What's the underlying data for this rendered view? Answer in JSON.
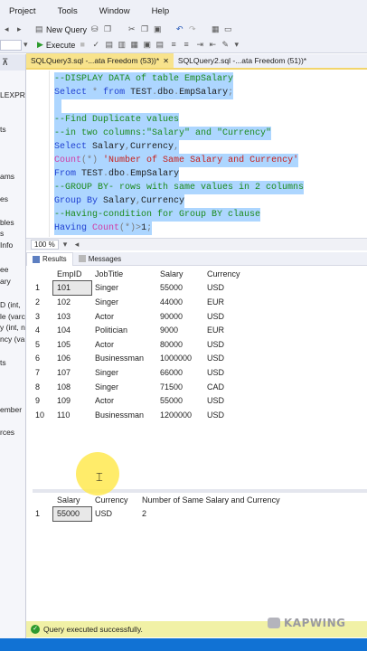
{
  "menu": [
    "Project",
    "Tools",
    "Window",
    "Help"
  ],
  "toolbar": {
    "new_query_label": "New Query",
    "execute_label": "Execute"
  },
  "left_panel": {
    "items": [
      "LEXPR",
      "ts",
      "ams",
      "es",
      "bles",
      "s",
      "Info",
      "ee",
      "ary",
      "D (int,",
      "le (varc",
      "y (int, n",
      "ncy (va",
      "ts",
      "ember",
      "rces"
    ]
  },
  "tabs": [
    {
      "label": "SQLQuery3.sql -...ata Freedom (53))*",
      "active": true
    },
    {
      "label": "SQLQuery2.sql -...ata Freedom (51))*",
      "active": false
    }
  ],
  "editor": {
    "lines": [
      "--DISPLAY DATA of table EmpSalary",
      "Select * from TEST.dbo.EmpSalary;",
      "",
      "--Find Duplicate values",
      "--in two columns:\"Salary\" and \"Currency\"",
      "Select Salary,Currency,",
      "Count(*) 'Number of Same Salary and Currency'",
      "From TEST.dbo.EmpSalary",
      "--GROUP BY- rows with same values in 2 columns",
      "Group By Salary,Currency",
      "--Having-condition for Group BY clause",
      "Having Count(*)>1;"
    ]
  },
  "zoom": "100 %",
  "results_tabs": [
    "Results",
    "Messages"
  ],
  "grid1": {
    "columns": [
      "EmpID",
      "JobTitle",
      "Salary",
      "Currency"
    ],
    "rows": [
      [
        "1",
        "101",
        "Singer",
        "55000",
        "USD"
      ],
      [
        "2",
        "102",
        "Singer",
        "44000",
        "EUR"
      ],
      [
        "3",
        "103",
        "Actor",
        "90000",
        "USD"
      ],
      [
        "4",
        "104",
        "Politician",
        "9000",
        "EUR"
      ],
      [
        "5",
        "105",
        "Actor",
        "80000",
        "USD"
      ],
      [
        "6",
        "106",
        "Businessman",
        "1000000",
        "USD"
      ],
      [
        "7",
        "107",
        "Singer",
        "66000",
        "USD"
      ],
      [
        "8",
        "108",
        "Singer",
        "71500",
        "CAD"
      ],
      [
        "9",
        "109",
        "Actor",
        "55000",
        "USD"
      ],
      [
        "10",
        "110",
        "Businessman",
        "1200000",
        "USD"
      ]
    ]
  },
  "grid2": {
    "columns": [
      "Salary",
      "Currency",
      "Number of Same Salary and Currency"
    ],
    "rows": [
      [
        "1",
        "55000",
        "USD",
        "2"
      ]
    ]
  },
  "status": "Query executed successfully.",
  "watermark": "KAPWING"
}
